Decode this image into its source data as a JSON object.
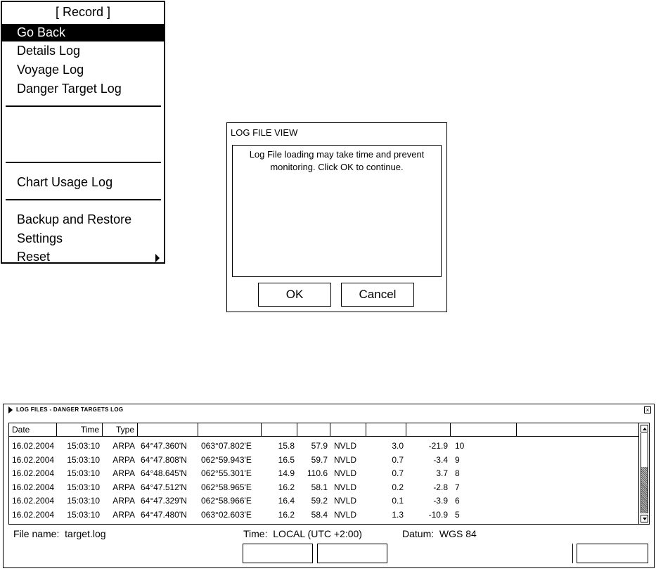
{
  "menu": {
    "title": "[ Record ]",
    "items": [
      "Go Back",
      "Details Log",
      "Voyage Log",
      "Danger Target Log",
      "Chart Usage Log",
      "Backup and Restore",
      "Settings",
      "Reset"
    ],
    "selected": "Go Back",
    "submenu_arrow": "arrow-right-icon"
  },
  "dialog": {
    "title": "LOG FILE VIEW",
    "message": "Log File loading may take time and prevent monitoring. Click OK to continue.",
    "ok_label": "OK",
    "cancel_label": "Cancel"
  },
  "log_window": {
    "title": "LOG FILES - DANGER TARGETS LOG",
    "columns": [
      "Date",
      "Time",
      "Type",
      "",
      "",
      "",
      "",
      "",
      "",
      "",
      "",
      ""
    ],
    "rows": [
      [
        "16.02.2004",
        "15:03:10",
        "ARPA",
        "64°47.360'N",
        "063°07.802'E",
        "15.8",
        "57.9",
        "NVLD",
        "3.0",
        "-21.9",
        "10"
      ],
      [
        "16.02.2004",
        "15:03:10",
        "ARPA",
        "64°47.808'N",
        "062°59.943'E",
        "16.5",
        "59.7",
        "NVLD",
        "0.7",
        "-3.4",
        "9"
      ],
      [
        "16.02.2004",
        "15:03:10",
        "ARPA",
        "64°48.645'N",
        "062°55.301'E",
        "14.9",
        "110.6",
        "NVLD",
        "0.7",
        "3.7",
        "8"
      ],
      [
        "16.02.2004",
        "15:03:10",
        "ARPA",
        "64°47.512'N",
        "062°58.965'E",
        "16.2",
        "58.1",
        "NVLD",
        "0.2",
        "-2.8",
        "7"
      ],
      [
        "16.02.2004",
        "15:03:10",
        "ARPA",
        "64°47.329'N",
        "062°58.966'E",
        "16.4",
        "59.2",
        "NVLD",
        "0.1",
        "-3.9",
        "6"
      ],
      [
        "16.02.2004",
        "15:03:10",
        "ARPA",
        "64°47.480'N",
        "063°02.603'E",
        "16.2",
        "58.4",
        "NVLD",
        "1.3",
        "-10.9",
        "5"
      ]
    ],
    "file_name_label": "File name:",
    "file_name": "target.log",
    "time_label": "Time:",
    "time_value": "LOCAL (UTC +2:00)",
    "datum_label": "Datum:",
    "datum_value": "WGS 84"
  }
}
